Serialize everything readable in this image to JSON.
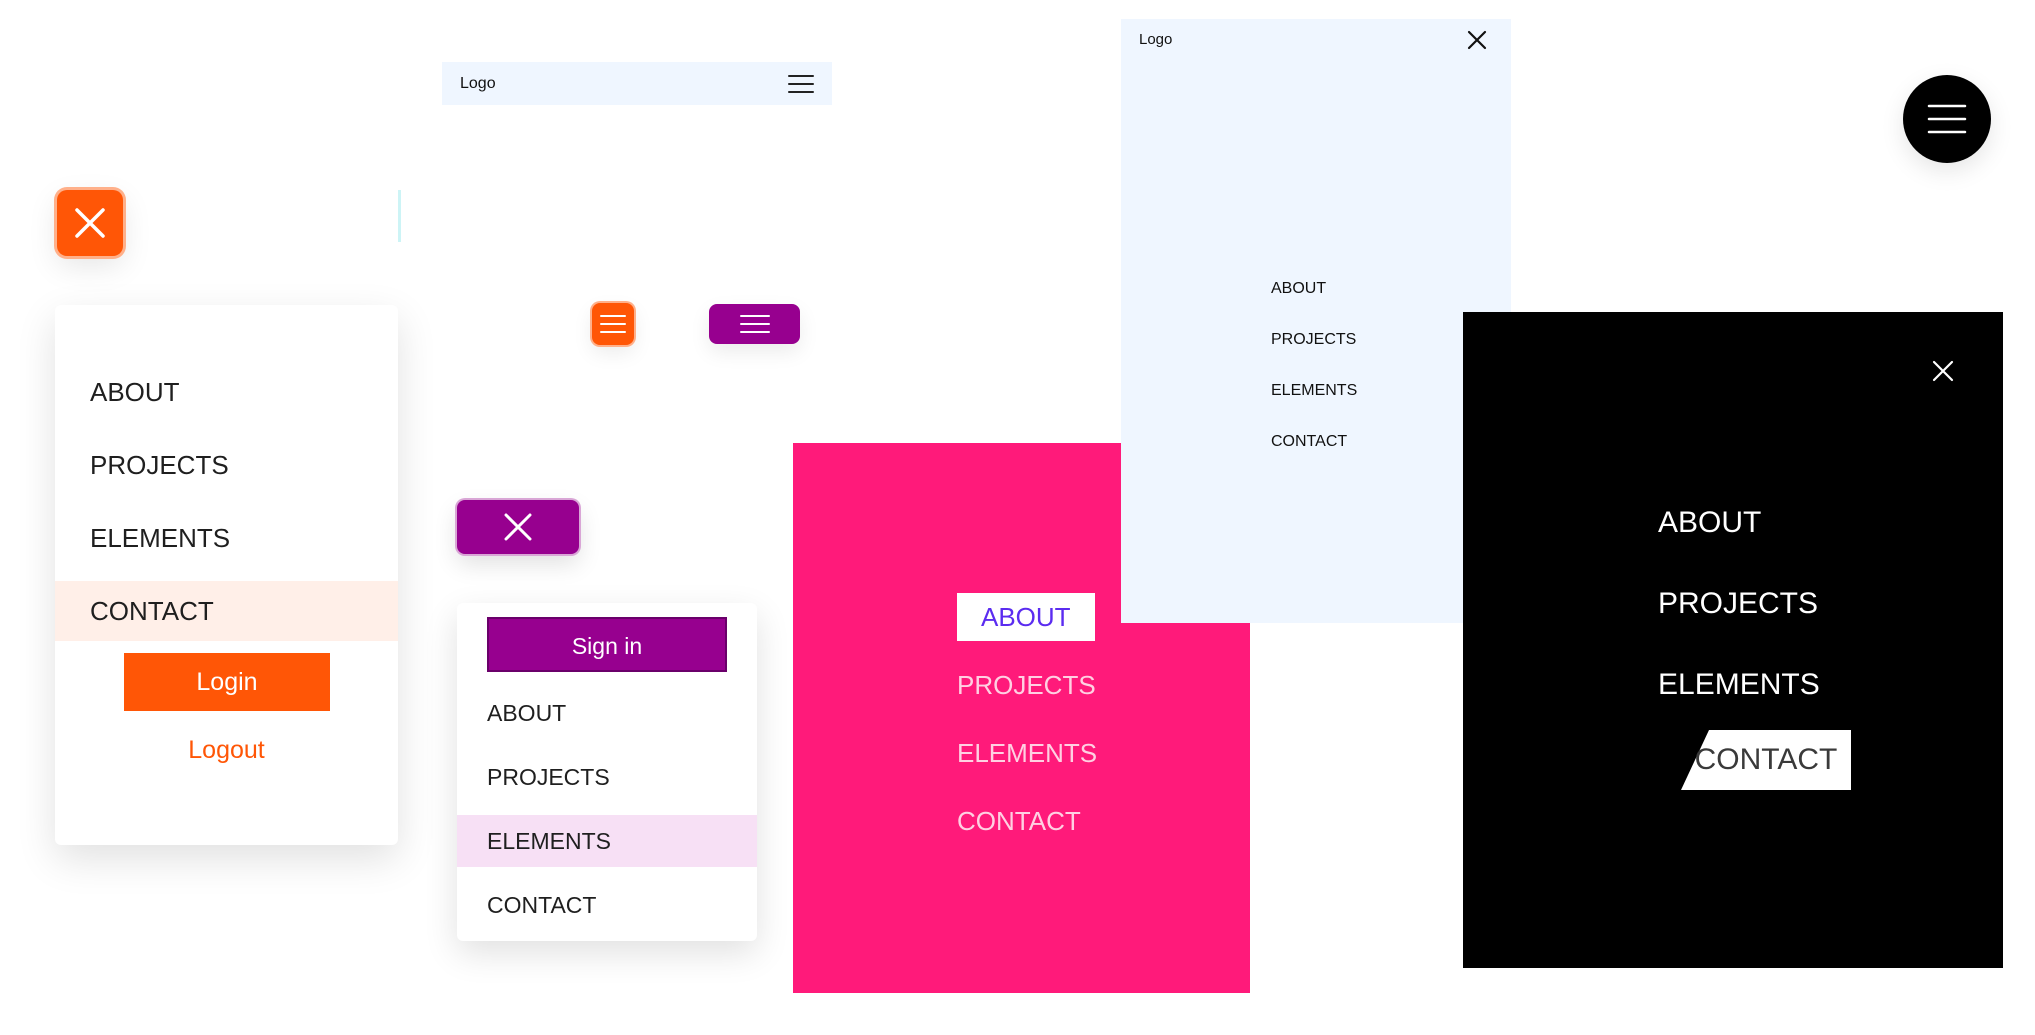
{
  "colors": {
    "orange": "#ff5606",
    "orange_active_bg": "#ffefe8",
    "purple": "#97008f",
    "purple_active_bg": "#f7e0f5",
    "pink": "#ff1a7a",
    "pink_active_text": "#5b2cf0",
    "light_blue": "#eff6ff",
    "black": "#000000"
  },
  "icons": [
    "close-icon",
    "hamburger-icon"
  ],
  "orange_menu": {
    "items": [
      "ABOUT",
      "PROJECTS",
      "ELEMENTS",
      "CONTACT"
    ],
    "active": "CONTACT",
    "login_label": "Login",
    "logout_label": "Logout"
  },
  "header_bar": {
    "logo": "Logo"
  },
  "purple_menu": {
    "signin_label": "Sign in",
    "items": [
      "ABOUT",
      "PROJECTS",
      "ELEMENTS",
      "CONTACT"
    ],
    "active": "ELEMENTS"
  },
  "pink_menu": {
    "items": [
      "ABOUT",
      "PROJECTS",
      "ELEMENTS",
      "CONTACT"
    ],
    "active": "ABOUT"
  },
  "blue_drawer": {
    "logo": "Logo",
    "items": [
      "ABOUT",
      "PROJECTS",
      "ELEMENTS",
      "CONTACT"
    ]
  },
  "black_menu": {
    "items": [
      "ABOUT",
      "PROJECTS",
      "ELEMENTS",
      "CONTACT"
    ],
    "active": "CONTACT"
  }
}
